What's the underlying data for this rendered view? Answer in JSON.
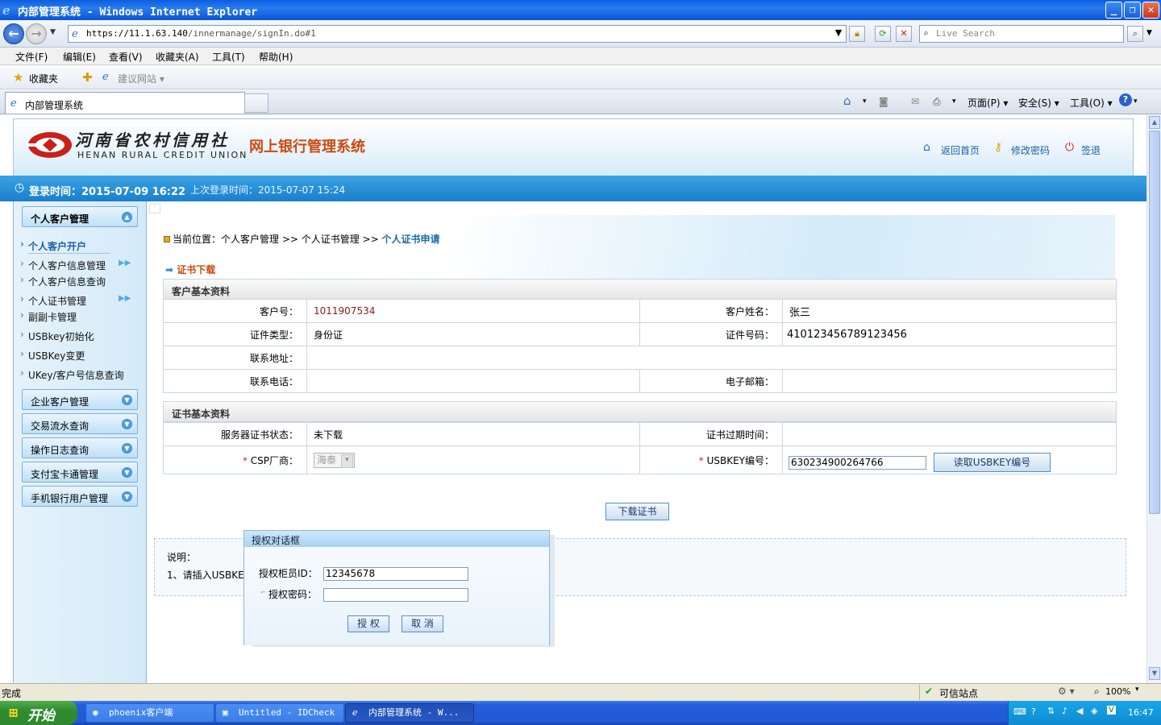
{
  "browser": {
    "window_title": "内部管理系统 - Windows Internet Explorer",
    "address_scheme": "https://",
    "address_host": "11.1.63.140",
    "address_path": "/innermanage/signIn.do#1",
    "search_placeholder": "Live Search",
    "menu": [
      "文件(F)",
      "编辑(E)",
      "查看(V)",
      "收藏夹(A)",
      "工具(T)",
      "帮助(H)"
    ],
    "favorites": {
      "label": "收藏夹",
      "suggested": "建议网站 ▾"
    },
    "tab_title": "内部管理系统",
    "commands": {
      "page": "页面(P) ▾",
      "safety": "安全(S) ▾",
      "tools": "工具(O) ▾"
    },
    "status_left": "完成",
    "status_trusted": "可信站点",
    "zoom": "100%"
  },
  "header": {
    "logo_cn": "河南省农村信用社",
    "logo_en": "HENAN RURAL CREDIT UNION",
    "system_title": "网上银行管理系统",
    "links": {
      "home": "返回首页",
      "change_password": "修改密码",
      "logout": "签退"
    }
  },
  "login_bar": {
    "login_time": "登录时间：2015-07-09 16:22",
    "last_login": "上次登录时间：2015-07-07 15:24"
  },
  "sidebar": {
    "personal": {
      "title": "个人客户管理",
      "items": [
        "个人客户开户",
        "个人客户信息管理",
        "个人客户信息查询",
        "个人证书管理",
        "副副卡管理",
        "USBkey初始化",
        "USBKey变更",
        "UKey/客户号信息查询"
      ]
    },
    "groups": [
      "企业客户管理",
      "交易流水查询",
      "操作日志查询",
      "支付宝卡通管理",
      "手机银行用户管理"
    ]
  },
  "main": {
    "breadcrumb_prefix": "当前位置：个人客户管理 >> 个人证书管理 >>",
    "breadcrumb_current": "个人证书申请",
    "section_title": "证书下载",
    "customer": {
      "header": "客户基本资料",
      "customer_no_label": "客户号：",
      "customer_no": "1011907534",
      "name_label": "客户姓名：",
      "name": "张三",
      "id_type_label": "证件类型：",
      "id_type": "身份证",
      "id_no_label": "证件号码：",
      "id_no": "410123456789123456",
      "address_label": "联系地址：",
      "phone_label": "联系电话：",
      "email_label": "电子邮箱："
    },
    "cert": {
      "header": "证书基本资料",
      "server_status_label": "服务器证书状态：",
      "server_status": "未下载",
      "expire_label": "证书过期时间：",
      "csp_label": "CSP厂商：",
      "csp_value": "海泰",
      "usbkey_label": "USBKEY编号：",
      "usbkey_value": "630234900264766",
      "read_usbkey_button": "读取USBKEY编号"
    },
    "download_button": "下载证书",
    "note_title": "说明：",
    "note_line": "1、请插入USBKEY"
  },
  "dialog": {
    "title": "授权对话框",
    "teller_id_label": "授权柜员ID：",
    "teller_id_value": "12345678",
    "password_label": "授权密码：",
    "authorize_button": "授 权",
    "cancel_button": "取 消"
  },
  "taskbar": {
    "start": "开始",
    "tasks": [
      "phoenix客户端",
      "Untitled - IDCheck",
      "内部管理系统 - W..."
    ],
    "clock": "16:47"
  }
}
